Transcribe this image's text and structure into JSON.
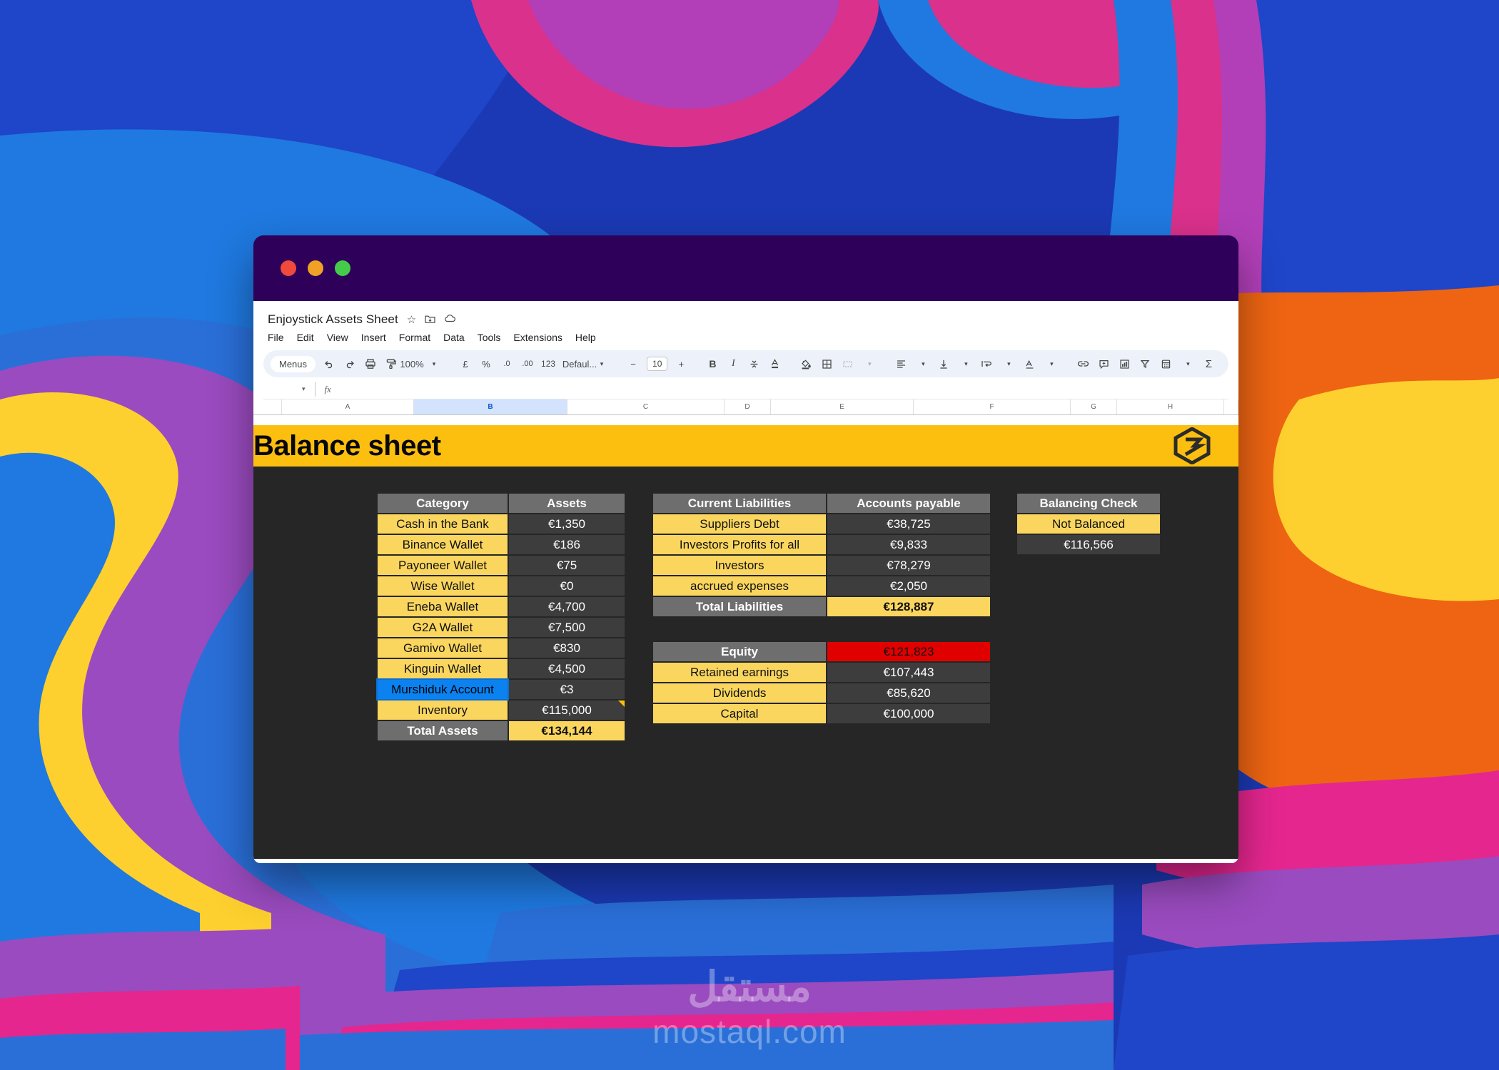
{
  "window": {
    "traffic_lights": [
      "close",
      "minimize",
      "maximize"
    ]
  },
  "app": {
    "doc_title": "Enjoystick Assets Sheet",
    "title_icons": [
      "star-icon",
      "move-to-folder-icon",
      "cloud-saved-icon"
    ],
    "menus": [
      "File",
      "Edit",
      "View",
      "Insert",
      "Format",
      "Data",
      "Tools",
      "Extensions",
      "Help"
    ],
    "toolbar": {
      "menus_label": "Menus",
      "zoom": "100%",
      "currency_icon": "£",
      "percent_icon": "%",
      "decrease_decimal": ".0",
      "increase_decimal": ".00",
      "more_formats": "123",
      "font_name": "Defaul...",
      "minus": "−",
      "font_size": "10",
      "plus": "+",
      "bold": "B",
      "italic": "I",
      "strikethrough": "strikethrough-icon",
      "text_color": "A",
      "fill_color": "fill-color-icon",
      "borders": "borders-icon",
      "merge_cells": "merge-cells-icon",
      "horizontal_align": "align-icon",
      "vertical_align": "valign-icon",
      "text_wrap": "wrap-icon",
      "text_rotation": "rotate-icon",
      "insert_link": "link-icon",
      "insert_comment": "comment-icon",
      "insert_chart": "chart-icon",
      "create_filter": "filter-icon",
      "functions": "Σ",
      "calculator": "calculator-icon"
    },
    "formula_bar": {
      "name_box": "",
      "fx_label": "fx",
      "formula": ""
    },
    "columns": [
      "A",
      "B",
      "C",
      "D",
      "E",
      "F",
      "G",
      "H"
    ],
    "selected_column": "B"
  },
  "sheet": {
    "banner_title": "Balance sheet",
    "logo": "enjoystick-logo",
    "colors": {
      "banner": "#fcbf10",
      "background": "#262626",
      "header_gray": "#6e6e6e",
      "label_yellow": "#fbd65f",
      "value_gray": "#3d3d3d",
      "selection_blue": "#0b82f0",
      "alert_red": "#e00000"
    },
    "assets_table": {
      "headers": [
        "Category",
        "Assets"
      ],
      "rows": [
        {
          "label": "Cash in the Bank",
          "value": "€1,350"
        },
        {
          "label": "Binance Wallet",
          "value": "€186"
        },
        {
          "label": "Payoneer Wallet",
          "value": "€75"
        },
        {
          "label": "Wise Wallet",
          "value": "€0"
        },
        {
          "label": "Eneba Wallet",
          "value": "€4,700"
        },
        {
          "label": "G2A Wallet",
          "value": "€7,500"
        },
        {
          "label": "Gamivo Wallet",
          "value": "€830"
        },
        {
          "label": "Kinguin Wallet",
          "value": "€4,500"
        },
        {
          "label": "Murshiduk Account",
          "value": "€3",
          "selected": true
        },
        {
          "label": "Inventory",
          "value": "€115,000",
          "overflow": true
        }
      ],
      "total": {
        "label": "Total Assets",
        "value": "€134,144"
      }
    },
    "liabilities_table": {
      "headers": [
        "Current Liabilities",
        "Accounts payable"
      ],
      "rows": [
        {
          "label": "Suppliers Debt",
          "value": "€38,725"
        },
        {
          "label": "Investors Profits for all",
          "value": "€9,833"
        },
        {
          "label": "Investors",
          "value": "€78,279"
        },
        {
          "label": "accrued expenses",
          "value": "€2,050"
        }
      ],
      "total": {
        "label": "Total Liabilities",
        "value": "€128,887"
      }
    },
    "equity_table": {
      "header": {
        "label": "Equity",
        "value": "€121,823"
      },
      "rows": [
        {
          "label": "Retained earnings",
          "value": "€107,443"
        },
        {
          "label": "Dividends",
          "value": "€85,620"
        },
        {
          "label": "Capital",
          "value": "€100,000"
        }
      ]
    },
    "balancing_check": {
      "header": "Balancing Check",
      "status": "Not Balanced",
      "difference": "€116,566"
    }
  },
  "watermark": {
    "arabic": "مستقل",
    "latin": "mostaql.com"
  }
}
